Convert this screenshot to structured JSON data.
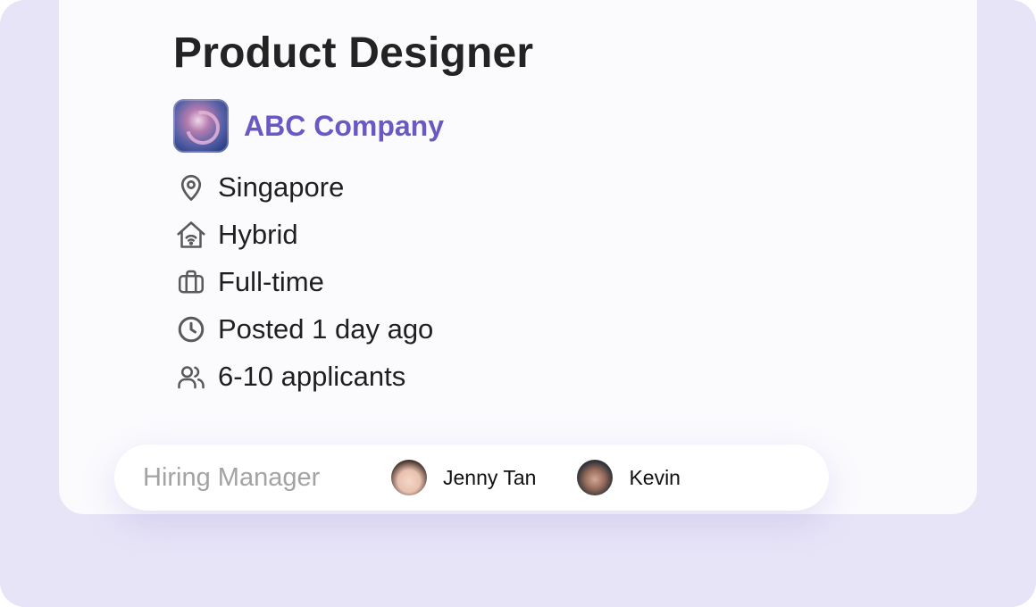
{
  "job": {
    "title": "Product Designer",
    "company": "ABC Company",
    "location": "Singapore",
    "work_mode": "Hybrid",
    "employment_type": "Full-time",
    "posted": "Posted 1 day ago",
    "applicants": "6-10 applicants"
  },
  "icons": {
    "company_logo": "abc-company-logo",
    "location": "map-pin-icon",
    "work_mode": "home-wifi-icon",
    "employment_type": "briefcase-icon",
    "posted": "clock-icon",
    "applicants": "users-icon"
  },
  "hiring": {
    "label": "Hiring Manager",
    "managers": [
      {
        "name": "Jenny Tan"
      },
      {
        "name": "Kevin"
      }
    ]
  },
  "colors": {
    "background": "#e7e4f7",
    "card": "#fbfbfe",
    "accent": "#6a59c4",
    "title": "#232323",
    "muted": "#a3a3a3"
  }
}
